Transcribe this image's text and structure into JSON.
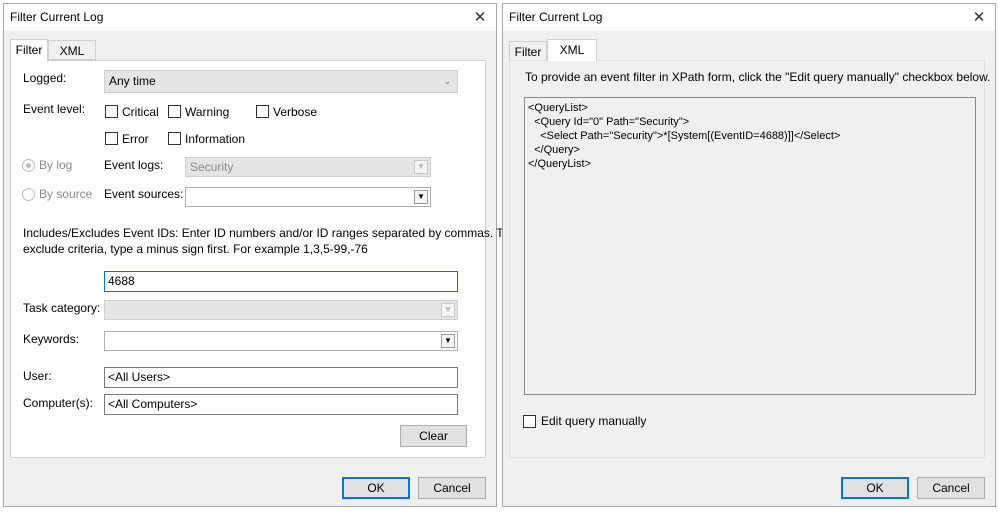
{
  "left_dialog": {
    "title": "Filter Current Log",
    "close_glyph": "✕",
    "tabs": [
      {
        "label": "Filter",
        "active": true
      },
      {
        "label": "XML",
        "active": false
      }
    ],
    "logged_label": "Logged:",
    "logged_value": "Any time",
    "event_level_label": "Event level:",
    "levels": [
      "Critical",
      "Warning",
      "Verbose",
      "Error",
      "Information"
    ],
    "by_log_label": "By log",
    "by_source_label": "By source",
    "event_logs_label": "Event logs:",
    "event_logs_value": "Security",
    "event_sources_label": "Event sources:",
    "event_sources_value": "",
    "includes_text_line1": "Includes/Excludes Event IDs: Enter ID numbers and/or ID ranges separated by commas. To",
    "includes_text_line2": "exclude criteria, type a minus sign first. For example 1,3,5-99,-76",
    "event_ids_value": "4688",
    "task_category_label": "Task category:",
    "task_category_value": "",
    "keywords_label": "Keywords:",
    "keywords_value": "",
    "user_label": "User:",
    "user_value": "<All Users>",
    "computer_label": "Computer(s):",
    "computer_value": "<All Computers>",
    "clear_label": "Clear",
    "ok_label": "OK",
    "cancel_label": "Cancel"
  },
  "right_dialog": {
    "title": "Filter Current Log",
    "close_glyph": "✕",
    "tabs": [
      {
        "label": "Filter",
        "active": false
      },
      {
        "label": "XML",
        "active": true
      }
    ],
    "instruction": "To provide an event filter in XPath form, click the \"Edit query manually\" checkbox below.",
    "xml_query": "<QueryList>\n  <Query Id=\"0\" Path=\"Security\">\n    <Select Path=\"Security\">*[System[(EventID=4688)]]</Select>\n  </Query>\n</QueryList>",
    "edit_manually_label": "Edit query manually",
    "ok_label": "OK",
    "cancel_label": "Cancel"
  },
  "colors": {
    "dialog_bg": "#f0f0f0",
    "focus_border": "#0078d7",
    "button_bg": "#e1e1e1"
  }
}
